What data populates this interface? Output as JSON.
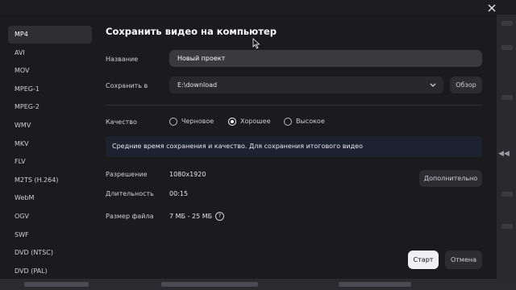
{
  "sidebar": {
    "formats": [
      "MP4",
      "AVI",
      "MOV",
      "MPEG-1",
      "MPEG-2",
      "WMV",
      "MKV",
      "FLV",
      "M2TS (H.264)",
      "WebM",
      "OGV",
      "SWF",
      "DVD (NTSC)",
      "DVD (PAL)"
    ],
    "active_index": 0
  },
  "dialog": {
    "title": "Сохранить видео на компьютер",
    "name_label": "Название",
    "name_value": "Новый проект",
    "save_to_label": "Сохранить в",
    "save_path": "E:\\download",
    "browse_label": "Обзор",
    "quality_label": "Качество",
    "quality_options": [
      "Черновое",
      "Хорошее",
      "Высокое"
    ],
    "quality_selected": "Хорошее",
    "info_text": "Средние время сохранения и качество. Для сохранения итогового видео",
    "resolution_label": "Разрешение",
    "resolution_value": "1080x1920",
    "duration_label": "Длительность",
    "duration_value": "00:15",
    "filesize_label": "Размер файла",
    "filesize_value": "7 МБ - 25 МБ",
    "help_glyph": "?",
    "more_label": "Дополнительно",
    "start_label": "Старт",
    "cancel_label": "Отмена"
  },
  "background": {
    "right_arrows": "◀◀"
  },
  "colors": {
    "dialog_bg": "#1b1b1e",
    "input_bg": "#39393e",
    "info_bg": "#1c2230",
    "primary_button": "#f0f0f2"
  },
  "icons": [
    "close-icon",
    "chevron-down-icon",
    "help-icon",
    "cursor-icon"
  ]
}
